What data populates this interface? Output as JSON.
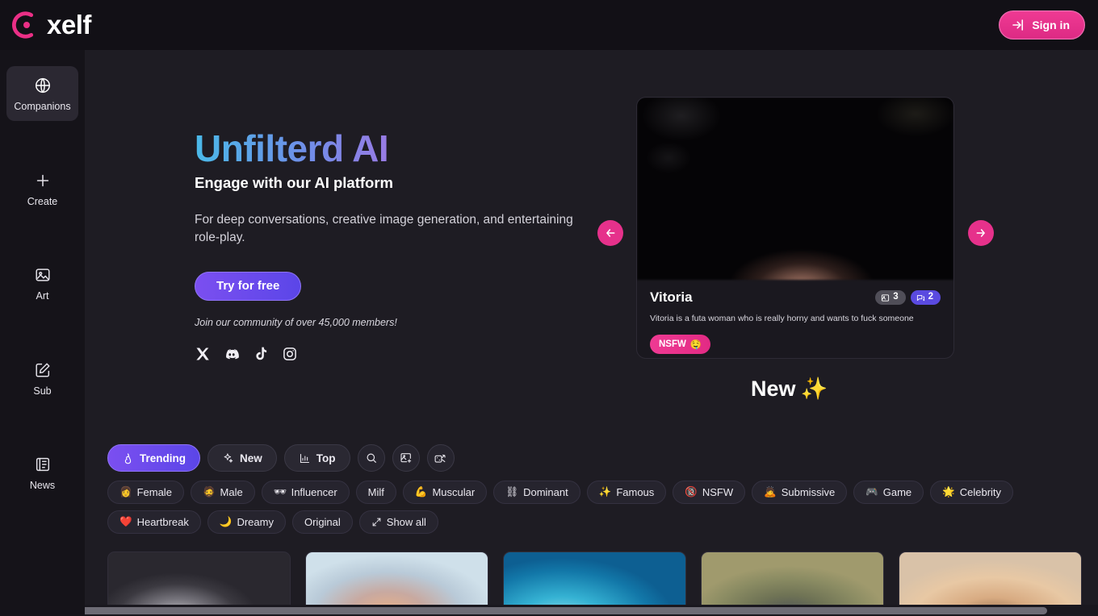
{
  "colors": {
    "page_bg": "#1e1c23",
    "header_bg": "#121016",
    "sidebar_bg": "#151319",
    "accent_pink": "#e6318b",
    "accent_purple": "#6b4bec",
    "card_bg": "#1a181f"
  },
  "header": {
    "logo_text": "xelf",
    "logo_icon": "xelf-radial-logo-icon",
    "signin_label": "Sign in",
    "signin_icon": "sign-in-arrow-icon"
  },
  "sidebar": {
    "items": [
      {
        "label": "Companions",
        "icon": "globe-icon",
        "active": true
      },
      {
        "label": "Create",
        "icon": "plus-icon",
        "active": false
      },
      {
        "label": "Art",
        "icon": "image-icon",
        "active": false
      },
      {
        "label": "Sub",
        "icon": "pencil-square-icon",
        "active": false
      },
      {
        "label": "News",
        "icon": "newspaper-icon",
        "active": false
      }
    ]
  },
  "hero": {
    "title": "Unfilterd AI",
    "subtitle": "Engage with our AI platform",
    "description": "For deep conversations, creative image generation, and entertaining role-play.",
    "cta_label": "Try for free",
    "members_note": "Join our community of over 45,000 members!",
    "socials": [
      {
        "name": "x-twitter-icon",
        "label": "X"
      },
      {
        "name": "discord-icon",
        "label": "Discord"
      },
      {
        "name": "tiktok-icon",
        "label": "TikTok"
      },
      {
        "name": "instagram-icon",
        "label": "Instagram"
      }
    ]
  },
  "carousel": {
    "prev_icon": "arrow-left-icon",
    "next_icon": "arrow-right-icon",
    "card": {
      "name": "Vitoria",
      "description": "Vitoria is a futa woman who is really horny and wants to fuck someone",
      "image_count": "3",
      "chat_count": "2",
      "image_badge_icon": "image-count-icon",
      "chat_badge_icon": "chat-count-icon",
      "tag_label": "NSFW",
      "tag_emoji": "🤤"
    }
  },
  "sections": {
    "new_heading": "New",
    "new_heading_emoji": "✨"
  },
  "filter_tabs": [
    {
      "label": "Trending",
      "icon": "flame-icon",
      "active": true
    },
    {
      "label": "New",
      "icon": "sparkles-icon",
      "active": false
    },
    {
      "label": "Top",
      "icon": "bar-chart-icon",
      "active": false
    }
  ],
  "tool_buttons": [
    {
      "name": "search-icon",
      "label": "Search"
    },
    {
      "name": "image-plus-icon",
      "label": "Generate image"
    },
    {
      "name": "dice-shuffle-icon",
      "label": "Random"
    }
  ],
  "chips": [
    {
      "label": "Female",
      "emoji": "👩"
    },
    {
      "label": "Male",
      "emoji": "🧔"
    },
    {
      "label": "Influencer",
      "emoji": "🕶"
    },
    {
      "label": "Milf",
      "emoji": ""
    },
    {
      "label": "Muscular",
      "emoji": "💪"
    },
    {
      "label": "Dominant",
      "emoji": "⛓"
    },
    {
      "label": "Famous",
      "emoji": "✨"
    },
    {
      "label": "NSFW",
      "emoji": "🔞"
    },
    {
      "label": "Submissive",
      "emoji": "🙇"
    },
    {
      "label": "Game",
      "emoji": "🎮"
    },
    {
      "label": "Celebrity",
      "emoji": "🌟"
    },
    {
      "label": "Heartbreak",
      "emoji": "❤️"
    },
    {
      "label": "Dreamy",
      "emoji": "🌙"
    },
    {
      "label": "Original",
      "emoji": ""
    },
    {
      "label": "Show all",
      "emoji": "",
      "icon": "expand-arrows-icon"
    }
  ],
  "card_strip": [
    {
      "name": "thumbnail-1"
    },
    {
      "name": "thumbnail-2"
    },
    {
      "name": "thumbnail-3"
    },
    {
      "name": "thumbnail-4"
    },
    {
      "name": "thumbnail-5"
    }
  ]
}
